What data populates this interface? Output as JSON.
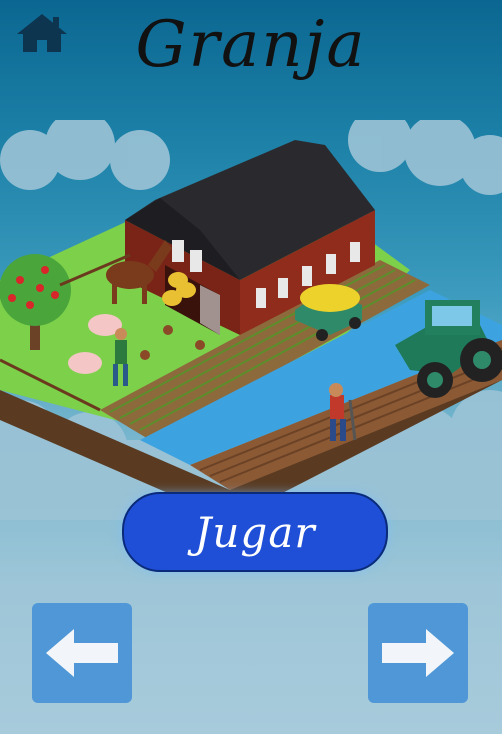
{
  "header": {
    "title": "Granja",
    "home_icon": "home-icon"
  },
  "main": {
    "play_label": "Jugar",
    "scene": "farm-illustration"
  },
  "navigation": {
    "prev_icon": "arrow-left-icon",
    "next_icon": "arrow-right-icon"
  },
  "colors": {
    "background_top": "#0b6791",
    "background_bottom": "#a7cbdb",
    "play_button": "#1e4fd6",
    "nav_button": "#4f97d6",
    "home_icon": "#0d3550"
  }
}
